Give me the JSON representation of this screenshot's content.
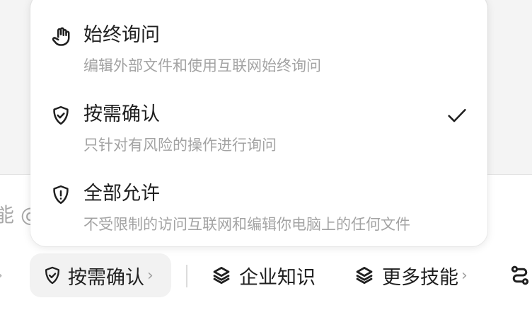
{
  "composer": {
    "placeholder_fragment": "能 @"
  },
  "toolbar": {
    "left_chevron": "›",
    "mode_chip": {
      "label": "按需确认",
      "chevron": "›",
      "icon": "shield-check-icon"
    },
    "knowledge": {
      "label": "企业知识",
      "icon": "layers-icon"
    },
    "skills": {
      "label": "更多技能",
      "chevron": "›",
      "icon": "layers-icon"
    },
    "partial_item": {
      "icon": "route-icon"
    }
  },
  "menu": {
    "items": [
      {
        "title": "始终询问",
        "description": "编辑外部文件和使用互联网始终询问",
        "icon": "hand-icon",
        "selected": false
      },
      {
        "title": "按需确认",
        "description": "只针对有风险的操作进行询问",
        "icon": "shield-check-icon",
        "selected": true
      },
      {
        "title": "全部允许",
        "description": "不受限制的访问互联网和编辑你电脑上的任何文件",
        "icon": "shield-alert-icon",
        "selected": false
      }
    ]
  },
  "colors": {
    "text_primary": "#1f1f1f",
    "text_secondary": "#a3a3a3",
    "chip_background": "#f2f2f2",
    "menu_background": "#ffffff"
  }
}
